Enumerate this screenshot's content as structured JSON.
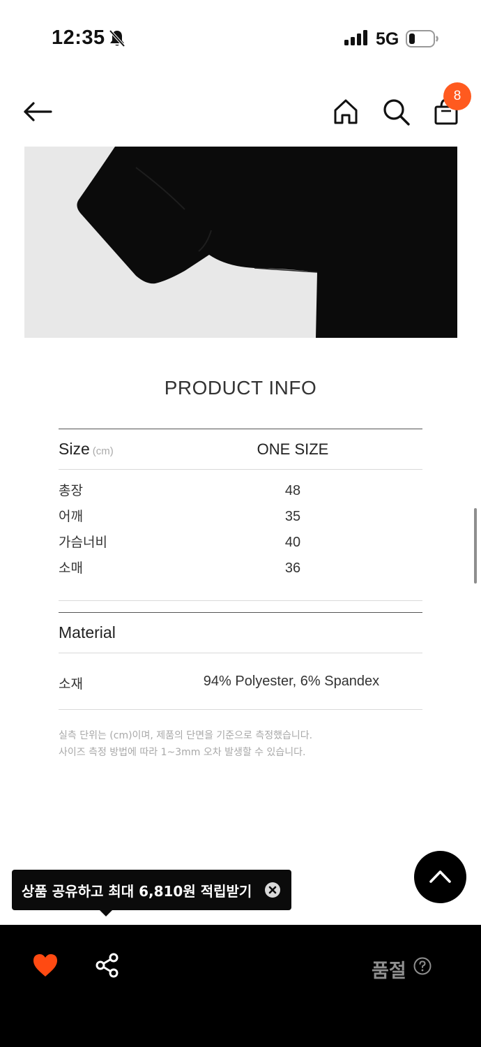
{
  "status_bar": {
    "time": "12:35",
    "network": "5G"
  },
  "nav": {
    "cart_count": "8"
  },
  "product_info": {
    "title": "PRODUCT INFO",
    "size_header": "Size",
    "size_unit": "(cm)",
    "size_column": "ONE SIZE",
    "rows": [
      {
        "label": "총장",
        "value": "48"
      },
      {
        "label": "어깨",
        "value": "35"
      },
      {
        "label": "가슴너비",
        "value": "40"
      },
      {
        "label": "소매",
        "value": "36"
      }
    ],
    "material_title": "Material",
    "material_label": "소재",
    "material_value": "94% Polyester, 6% Spandex",
    "note_line1": "실측 단위는 (cm)이며, 제품의 단면을 기준으로 측정했습니다.",
    "note_line2": "사이즈 측정 방법에 따라 1~3mm 오차 발생할 수 있습니다."
  },
  "toast": {
    "text": "상품 공유하고 최대 6,810원 적립받기"
  },
  "bottom_bar": {
    "status_label": "품절"
  },
  "colors": {
    "accent": "#ff5a1f",
    "bar": "#000000"
  }
}
